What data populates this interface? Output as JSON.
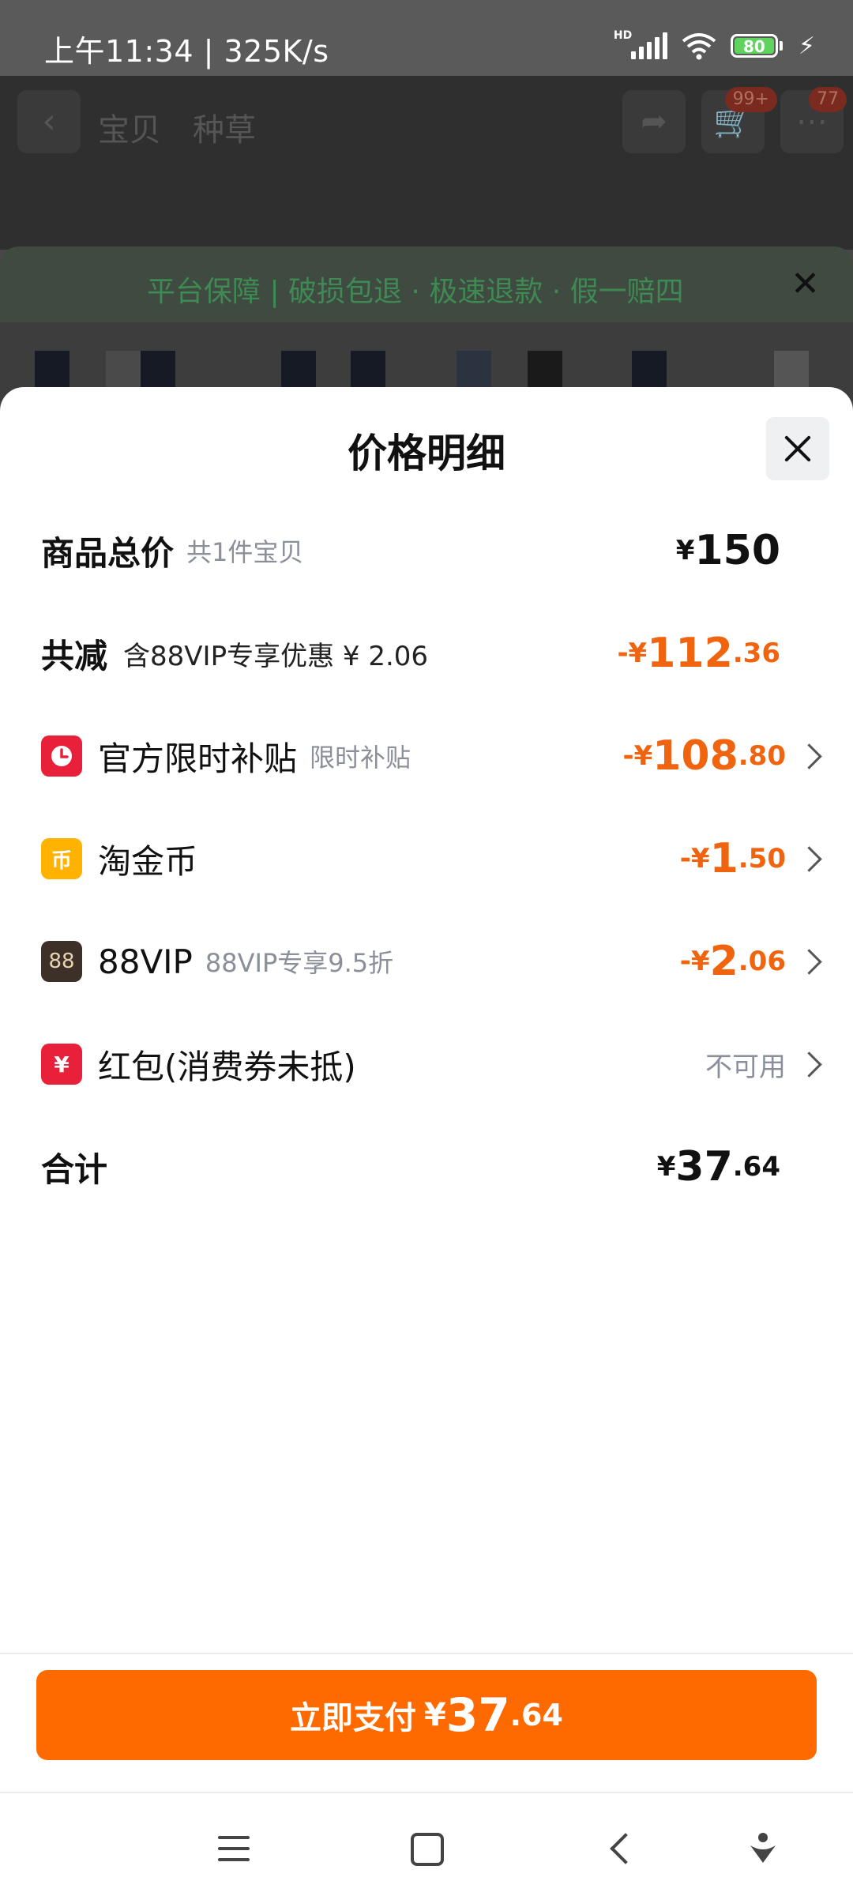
{
  "status_bar": {
    "time_speed": "上午11:34 | 325K/s",
    "battery": "80"
  },
  "background": {
    "tabs": [
      "宝贝",
      "种草"
    ],
    "cart_badge": "99+",
    "more_badge": "77",
    "guarantee": "平台保障 | 破损包退 · 极速退款 · 假一赔四"
  },
  "sheet": {
    "title": "价格明细",
    "rows": [
      {
        "label": "商品总价",
        "sub": "共1件宝贝",
        "currency": "¥",
        "int": "150",
        "dec": ""
      },
      {
        "label": "共减",
        "sub": "含88VIP专享优惠 ¥ 2.06",
        "currency": "-¥",
        "int": "112",
        "dec": ".36"
      },
      {
        "label": "官方限时补贴",
        "sub": "限时补贴",
        "currency": "-¥",
        "int": "108",
        "dec": ".80"
      },
      {
        "label": "淘金币",
        "sub": "",
        "currency": "-¥",
        "int": "1",
        "dec": ".50"
      },
      {
        "label": "88VIP",
        "sub": "88VIP专享9.5折",
        "currency": "-¥",
        "int": "2",
        "dec": ".06"
      },
      {
        "label": "红包(消费券未抵)",
        "sub": "",
        "value": "不可用"
      },
      {
        "label": "合计",
        "sub": "",
        "currency": "¥",
        "int": "37",
        "dec": ".64"
      }
    ],
    "icons": {
      "subsidy": "clock-icon",
      "coin": "coin-icon",
      "vip": "vip88-icon",
      "hongbao": "red-packet-icon"
    },
    "icon_text": {
      "coin": "币",
      "vip": "88",
      "hongbao": "¥"
    }
  },
  "pay_button": {
    "label": "立即支付",
    "currency": "¥",
    "int": "37",
    "dec": ".64"
  },
  "colors": {
    "accent_orange": "#ff6a00",
    "discount_orange": "#f0640f",
    "subsidy_red": "#e8203a",
    "coin_yellow": "#ffb200",
    "vip_brown": "#3d3029"
  }
}
